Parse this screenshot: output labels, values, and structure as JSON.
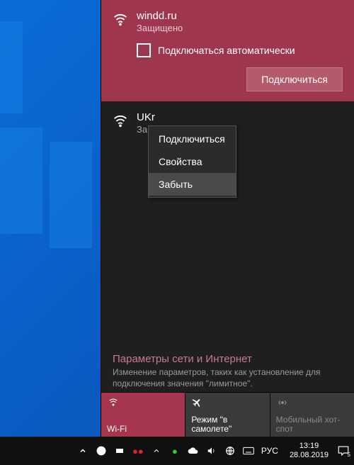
{
  "selected_network": {
    "name": "windd.ru",
    "status": "Защищено",
    "autoconnect_label": "Подключаться автоматически",
    "connect_button": "Подключиться"
  },
  "other_network": {
    "name": "UKr",
    "status": "Защ"
  },
  "context_menu": {
    "connect": "Подключиться",
    "properties": "Свойства",
    "forget": "Забыть"
  },
  "settings": {
    "title": "Параметры сети и Интернет",
    "description": "Изменение параметров, таких как установление для подключения значения \"лимитное\"."
  },
  "tiles": {
    "wifi": "Wi-Fi",
    "airplane": "Режим \"в самолете\"",
    "hotspot": "Мобильный хот-спот"
  },
  "taskbar": {
    "language": "РУС",
    "time": "13:19",
    "date": "28.08.2019",
    "notif_count": "5"
  }
}
